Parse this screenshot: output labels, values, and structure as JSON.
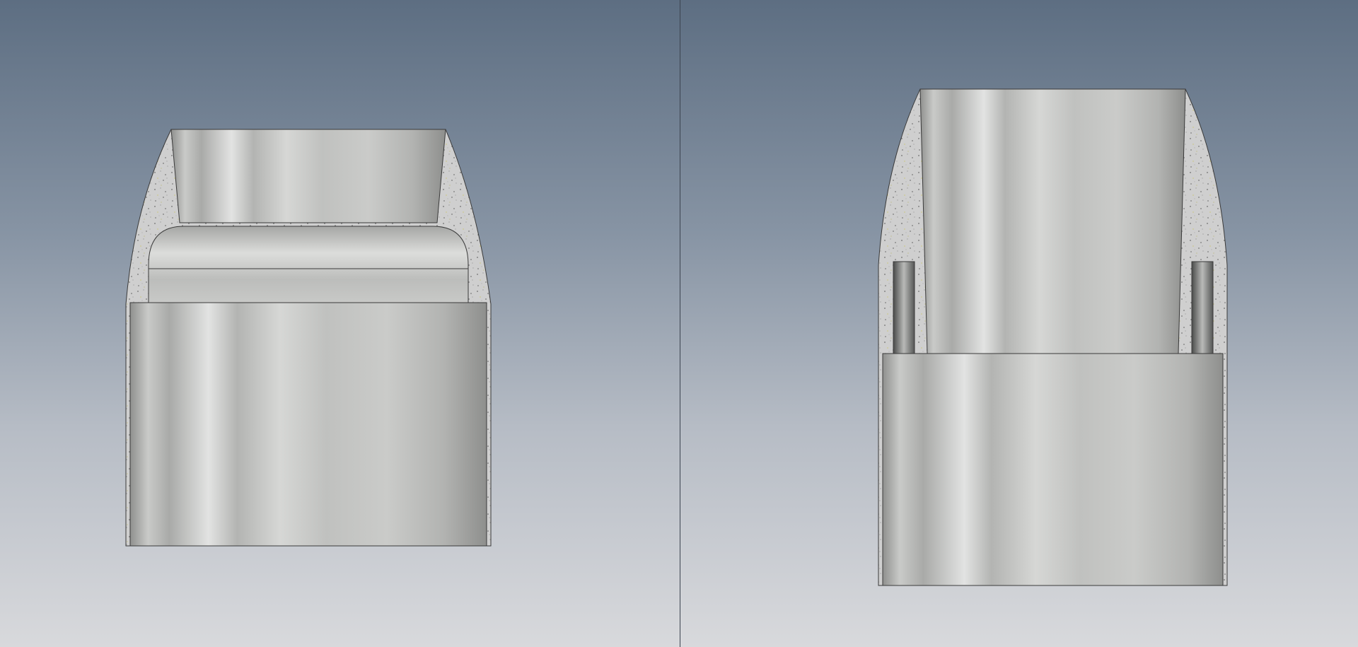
{
  "app": {
    "view_mode": "split-viewport",
    "render_style": "realistic-metal-section"
  },
  "colors": {
    "background_top": "#5d6e82",
    "background_mid": "#8794a4",
    "background_bottom": "#d8d9dc",
    "metal_dark": "#9e9e9c",
    "metal_light": "#e3e4e3",
    "concrete_base": "#cfcfcf",
    "concrete_speck_dark": "#6f6f6f",
    "concrete_speck_yellow": "#c9c24a",
    "outline": "#3a3a3a",
    "splitter": "#3c4450"
  },
  "viewports": [
    {
      "name": "left-viewport",
      "content": "section-view-tapered-cap-with-fillet"
    },
    {
      "name": "right-viewport",
      "content": "section-view-tapered-cap-with-slots"
    }
  ]
}
